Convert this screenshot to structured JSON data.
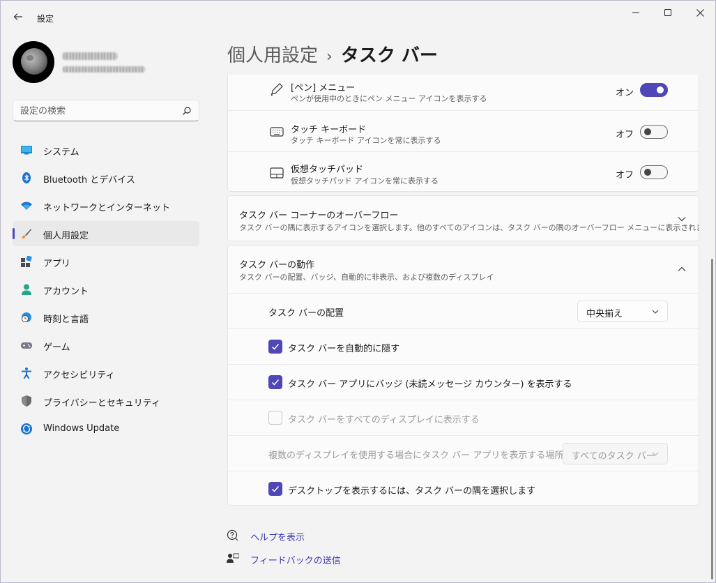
{
  "window": {
    "title": "設定",
    "controls": {
      "minimize": "minimize-icon",
      "maximize": "maximize-icon",
      "close": "close-icon"
    }
  },
  "sidebar": {
    "search_placeholder": "設定の検索",
    "items": [
      {
        "label": "システム",
        "icon": "system-icon"
      },
      {
        "label": "Bluetooth とデバイス",
        "icon": "bluetooth-icon"
      },
      {
        "label": "ネットワークとインターネット",
        "icon": "wifi-icon"
      },
      {
        "label": "個人用設定",
        "icon": "brush-icon",
        "active": true
      },
      {
        "label": "アプリ",
        "icon": "apps-icon"
      },
      {
        "label": "アカウント",
        "icon": "account-icon"
      },
      {
        "label": "時刻と言語",
        "icon": "time-language-icon"
      },
      {
        "label": "ゲーム",
        "icon": "gamepad-icon"
      },
      {
        "label": "アクセシビリティ",
        "icon": "accessibility-icon"
      },
      {
        "label": "プライバシーとセキュリティ",
        "icon": "shield-icon"
      },
      {
        "label": "Windows Update",
        "icon": "update-icon"
      }
    ]
  },
  "header": {
    "parent": "個人用設定",
    "separator": "›",
    "current": "タスク バー"
  },
  "taskbar_icons": [
    {
      "title": "[ペン] メニュー",
      "subtitle": "ペンが使用中のときにペン メニュー アイコンを表示する",
      "state_label": "オン",
      "on": true,
      "icon": "pen-icon"
    },
    {
      "title": "タッチ キーボード",
      "subtitle": "タッチ キーボード アイコンを常に表示する",
      "state_label": "オフ",
      "on": false,
      "icon": "keyboard-icon"
    },
    {
      "title": "仮想タッチパッド",
      "subtitle": "仮想タッチパッド アイコンを常に表示する",
      "state_label": "オフ",
      "on": false,
      "icon": "touchpad-icon"
    }
  ],
  "overflow_section": {
    "title": "タスク バー コーナーのオーバーフロー",
    "subtitle": "タスク バーの隅に表示するアイコンを選択します。他のすべてのアイコンは、タスク バーの隅のオーバーフロー メニューに表示されます"
  },
  "behavior_section": {
    "title": "タスク バーの動作",
    "subtitle": "タスク バーの配置、バッジ、自動的に非表示、および複数のディスプレイ",
    "alignment_label": "タスク バーの配置",
    "alignment_value": "中央揃え",
    "options": [
      {
        "label": "タスク バーを自動的に隠す",
        "checked": true,
        "disabled": false
      },
      {
        "label": "タスク バー アプリにバッジ (未読メッセージ カウンター) を表示する",
        "checked": true,
        "disabled": false
      },
      {
        "label": "タスク バーをすべてのディスプレイに表示する",
        "checked": false,
        "disabled": true
      }
    ],
    "multi_display_label": "複数のディスプレイを使用する場合にタスク バー アプリを表示する場所",
    "multi_display_value": "すべてのタスク バー",
    "corner_option": {
      "label": "デスクトップを表示するには、タスク バーの隅を選択します",
      "checked": true
    }
  },
  "footer": {
    "help": "ヘルプを表示",
    "feedback": "フィードバックの送信"
  },
  "colors": {
    "accent": "#4f46b8",
    "link": "#3c3ab0"
  }
}
